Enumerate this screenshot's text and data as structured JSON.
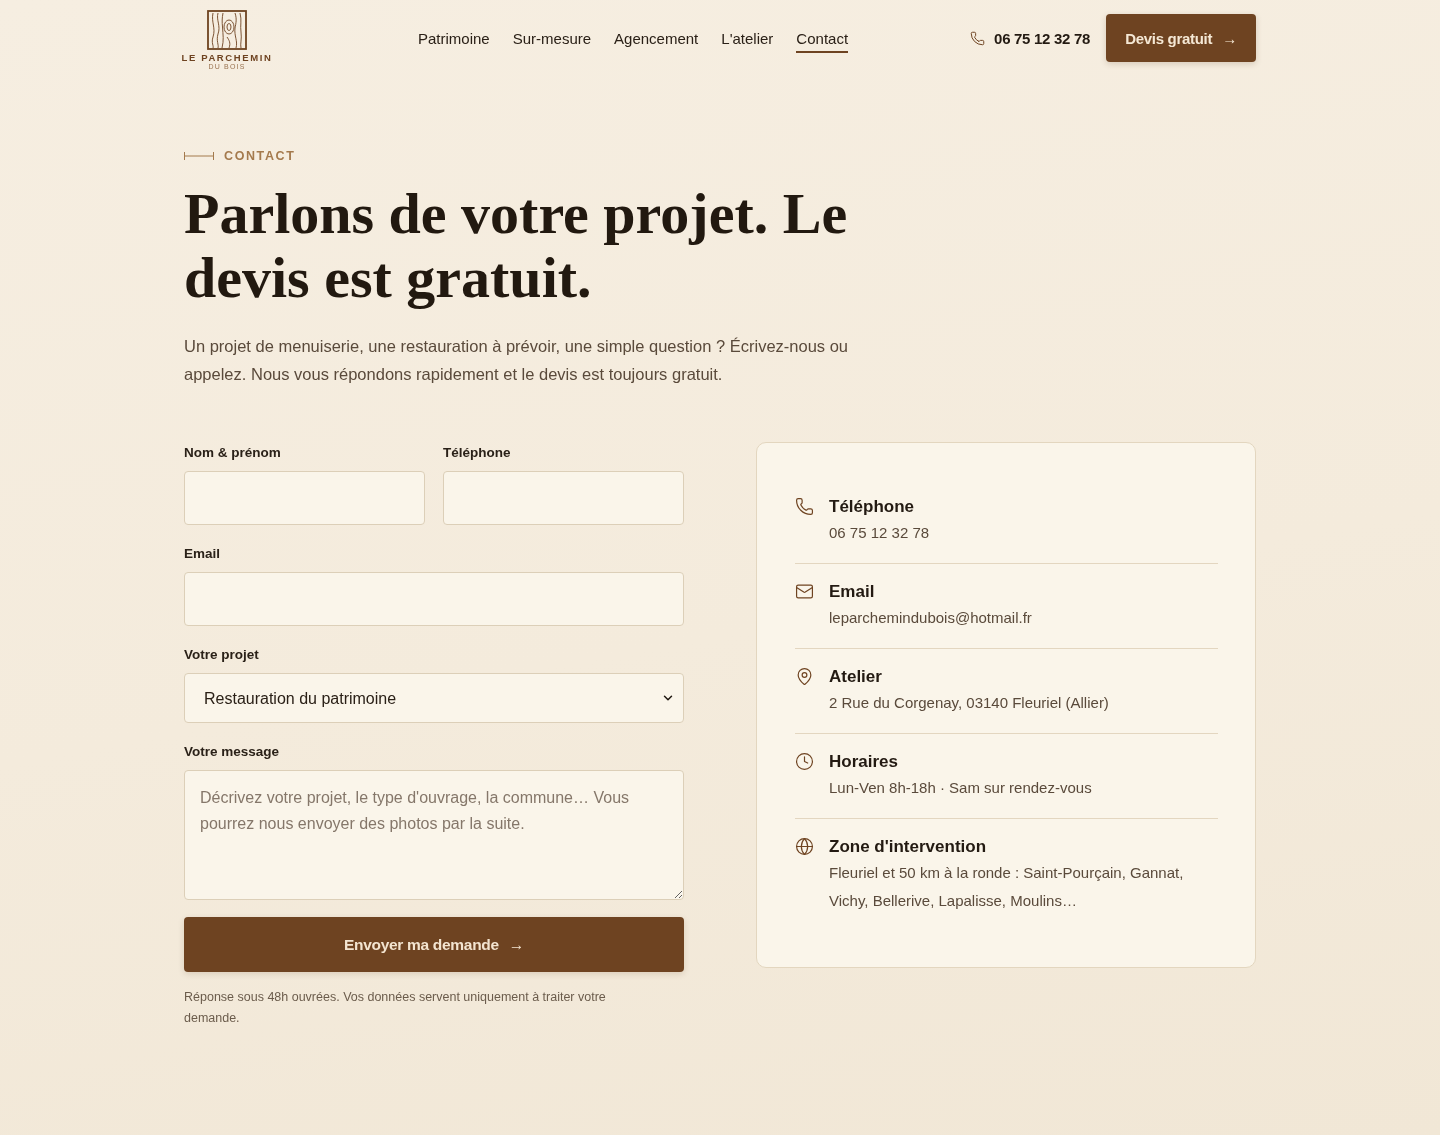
{
  "header": {
    "logo": {
      "name": "LE PARCHEMIN",
      "tagline": "DU BOIS"
    },
    "nav": [
      {
        "label": "Patrimoine",
        "selected": false
      },
      {
        "label": "Sur-mesure",
        "selected": false
      },
      {
        "label": "Agencement",
        "selected": false
      },
      {
        "label": "L'atelier",
        "selected": false
      },
      {
        "label": "Contact",
        "selected": true
      }
    ],
    "phone": "06 75 12 32 78",
    "cta": {
      "label": "Devis gratuit",
      "arrow": "→"
    }
  },
  "hero": {
    "eyebrow": "CONTACT",
    "title": "Parlons de votre projet. Le devis est gratuit.",
    "lead": "Un projet de menuiserie, une restauration à prévoir, une simple question ? Écrivez-nous ou appelez. Nous vous répondons rapidement et le devis est toujours gratuit."
  },
  "form": {
    "rows": [
      [
        {
          "kind": "input",
          "label": "Nom & prénom"
        },
        {
          "kind": "input",
          "label": "Téléphone"
        }
      ],
      [
        {
          "kind": "input",
          "label": "Email"
        }
      ],
      [
        {
          "kind": "select",
          "label": "Votre projet",
          "value": "Restauration du patrimoine"
        }
      ],
      [
        {
          "kind": "textarea",
          "label": "Votre message",
          "placeholder": "Décrivez votre projet, le type d'ouvrage, la commune… Vous pourrez nous envoyer des photos par la suite."
        }
      ]
    ],
    "submit": {
      "label": "Envoyer ma demande",
      "arrow": "→"
    },
    "note": "Réponse sous 48h ouvrées. Vos données servent uniquement à traiter votre demande."
  },
  "contact_card": {
    "items": [
      {
        "kind": "phone",
        "title": "Téléphone",
        "value": "06 75 12 32 78"
      },
      {
        "kind": "email",
        "title": "Email",
        "value": "leparchemindubois@hotmail.fr"
      },
      {
        "kind": "address",
        "title": "Atelier",
        "value": "2 Rue du Corgenay, 03140 Fleuriel (Allier)"
      },
      {
        "kind": "hours",
        "title": "Horaires",
        "value": "Lun-Ven 8h-18h · Sam sur rendez-vous"
      },
      {
        "kind": "area",
        "title": "Zone d'intervention",
        "value": "Fleuriel et 50 km à la ronde : Saint-Pourçain, Gannat, Vichy, Bellerive, Lapalisse, Moulins…"
      }
    ]
  }
}
